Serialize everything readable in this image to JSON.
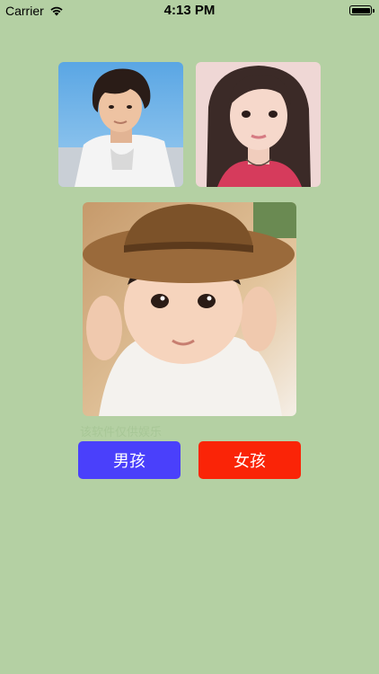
{
  "status_bar": {
    "carrier": "Carrier",
    "time": "4:13 PM",
    "icons": [
      "wifi-icon",
      "battery-icon"
    ]
  },
  "photos": {
    "father": "father-photo",
    "mother": "mother-photo",
    "baby": "baby-photo"
  },
  "disclaimer": "该软件仅供娱乐",
  "buttons": {
    "boy_label": "男孩",
    "girl_label": "女孩"
  },
  "colors": {
    "background": "#b4d0a3",
    "boy_button": "#4a40fb",
    "girl_button": "#fa2407",
    "disclaimer_text": "#a8c797"
  }
}
